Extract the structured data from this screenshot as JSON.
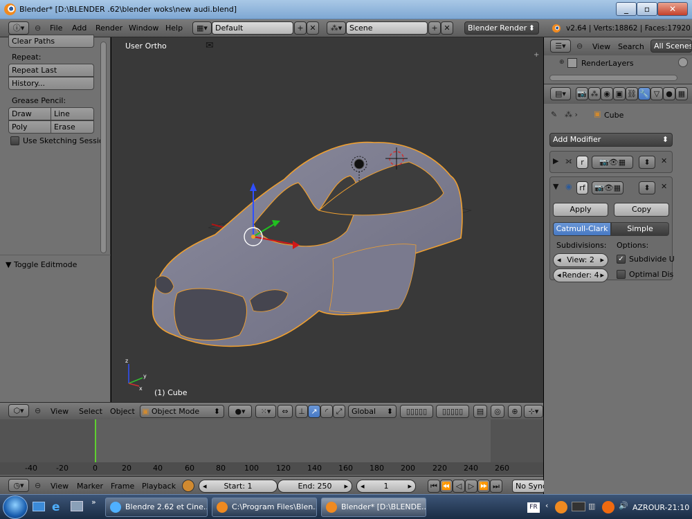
{
  "window": {
    "title": "Blender* [D:\\BLENDER .62\\blender woks\\new audi.blend]"
  },
  "header": {
    "menus": [
      "File",
      "Add",
      "Render",
      "Window",
      "Help"
    ],
    "layout": "Default",
    "scene": "Scene",
    "engine": "Blender Render",
    "stats": "v2.64 | Verts:18862 | Faces:17920"
  },
  "shelf": {
    "clear_paths": "Clear Paths",
    "repeat_label": "Repeat:",
    "repeat_last": "Repeat Last",
    "history": "History...",
    "grease_label": "Grease Pencil:",
    "draw": "Draw",
    "line": "Line",
    "poly": "Poly",
    "erase": "Erase",
    "sketching": "Use Sketching Sessio",
    "toggle_editmode": "Toggle Editmode"
  },
  "viewport": {
    "view_name": "User Ortho",
    "object_label": "(1) Cube"
  },
  "view_header": {
    "menus": [
      "View",
      "Select",
      "Object"
    ],
    "mode": "Object Mode",
    "orientation": "Global"
  },
  "timeline": {
    "ticks": [
      "-40",
      "-20",
      "0",
      "20",
      "40",
      "60",
      "80",
      "100",
      "120",
      "140",
      "160",
      "180",
      "200",
      "220",
      "240",
      "260"
    ],
    "menus": [
      "View",
      "Marker",
      "Frame",
      "Playback"
    ],
    "start": "Start: 1",
    "end": "End: 250",
    "current": "1",
    "sync": "No Sync"
  },
  "outliner": {
    "menus": [
      "View",
      "Search"
    ],
    "filter": "All Scenes",
    "item": "RenderLayers"
  },
  "properties": {
    "object": "Cube",
    "add_modifier": "Add Modifier",
    "mod1_name": "r",
    "mod2_name": "rf",
    "apply": "Apply",
    "copy": "Copy",
    "catmull": "Catmull-Clark",
    "simple": "Simple",
    "subdivisions_label": "Subdivisions:",
    "options_label": "Options:",
    "view_levels": "View: 2",
    "render_levels": "Render: 4",
    "subdivide_uv": "Subdivide U",
    "optimal_display": "Optimal Dis"
  },
  "taskbar": {
    "tasks": [
      "Blendre 2.62 et Cine...",
      "C:\\Program Files\\Blen...",
      "Blender* [D:\\BLENDE..."
    ],
    "lang": "FR",
    "clock": "AZROUR-21:10"
  },
  "colors": {
    "selection_orange": "#f0a030",
    "viewport_bg": "#393939",
    "panel_bg": "#727272",
    "accent_blue": "#4779c4"
  }
}
